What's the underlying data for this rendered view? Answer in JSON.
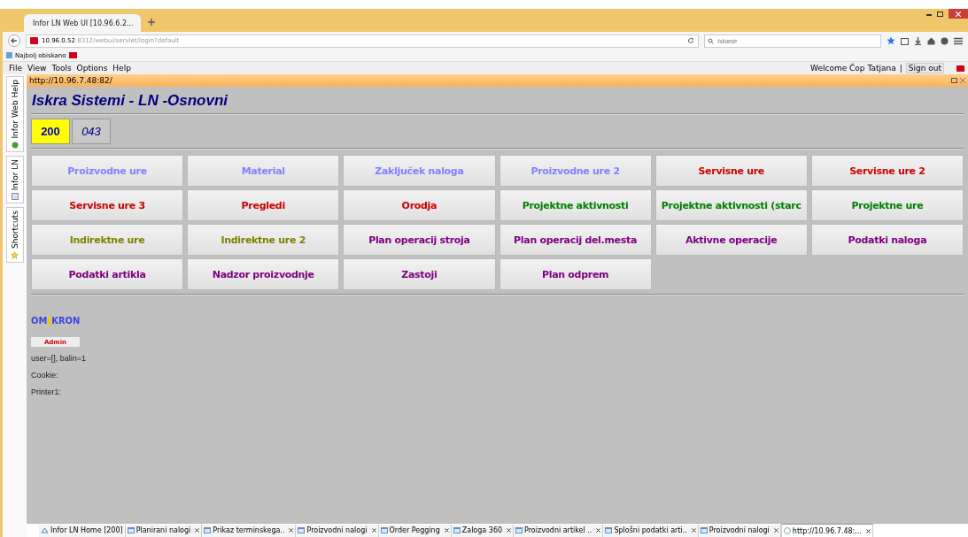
{
  "browser": {
    "tab_title": "Infor LN Web UI [10.96.6.2...",
    "url_host": "10.96.0.52",
    "url_rest": ":8312/webui/servlet/login?default",
    "search": {
      "placeholder": "Iskanje"
    },
    "bookmark": "Najbolj obiskano"
  },
  "menu": [
    "File",
    "View",
    "Tools",
    "Options",
    "Help"
  ],
  "user": {
    "welcome": "Welcome Čop Tatjana",
    "separator": "|",
    "sign_out": "Sign out"
  },
  "side_tabs": [
    {
      "label": "Infor Web Help",
      "kind": "help"
    },
    {
      "label": "Infor LN",
      "kind": "list"
    },
    {
      "label": "Shortcuts",
      "kind": "star"
    }
  ],
  "panel": {
    "url": "http://10.96.7.48:82/",
    "title": "Iskra Sistemi - LN -Osnovni",
    "companies": [
      {
        "label": "200",
        "selected": true
      },
      {
        "label": "043",
        "selected": false
      }
    ],
    "tiles": [
      {
        "label": "Proizvodne ure",
        "color": "#8080ff"
      },
      {
        "label": "Material",
        "color": "#8080ff"
      },
      {
        "label": "Zaključek naloga",
        "color": "#8080ff"
      },
      {
        "label": "Proizvodne ure 2",
        "color": "#8080ff"
      },
      {
        "label": "Servisne ure",
        "color": "#cc0000"
      },
      {
        "label": "Servisne ure 2",
        "color": "#cc0000"
      },
      {
        "label": "Servisne ure 3",
        "color": "#cc0000"
      },
      {
        "label": "Pregledi",
        "color": "#cc0000"
      },
      {
        "label": "Orodja",
        "color": "#cc0000"
      },
      {
        "label": "Projektne aktivnosti",
        "color": "#008000"
      },
      {
        "label": "Projektne aktivnosti (starc",
        "color": "#008000"
      },
      {
        "label": "Projektne ure",
        "color": "#008000"
      },
      {
        "label": "Indirektne ure",
        "color": "#808000"
      },
      {
        "label": "Indirektne ure 2",
        "color": "#808000"
      },
      {
        "label": "Plan operacij stroja",
        "color": "#800080"
      },
      {
        "label": "Plan operacij del.mesta",
        "color": "#800080"
      },
      {
        "label": "Aktivne operacije",
        "color": "#800080"
      },
      {
        "label": "Podatki naloga",
        "color": "#800080"
      },
      {
        "label": "Podatki artikla",
        "color": "#800080"
      },
      {
        "label": "Nadzor proizvodnje",
        "color": "#800080"
      },
      {
        "label": "Zastoji",
        "color": "#800080"
      },
      {
        "label": "Plan odprem",
        "color": "#800080"
      }
    ],
    "logo": [
      "OM",
      "KRON"
    ],
    "admin_button": "Admin",
    "info_lines": [
      "user=[], balin=1",
      "Cookie:",
      "Printer1:"
    ]
  },
  "bottom_tabs": [
    {
      "label": "Infor LN Home [200]",
      "kind": "home",
      "selected": false,
      "closable": false
    },
    {
      "label": "Planirani nalogi",
      "kind": "doc",
      "selected": false,
      "closable": true
    },
    {
      "label": "Prikaz terminskega..",
      "kind": "doc",
      "selected": false,
      "closable": true
    },
    {
      "label": "Proizvodni nalogi",
      "kind": "doc",
      "selected": false,
      "closable": true
    },
    {
      "label": "Order Pegging",
      "kind": "doc",
      "selected": false,
      "closable": true
    },
    {
      "label": "Zaloga 360",
      "kind": "doc",
      "selected": false,
      "closable": true
    },
    {
      "label": "Proizvodni artikel ..",
      "kind": "doc",
      "selected": false,
      "closable": true
    },
    {
      "label": "Splošni podatki arti..",
      "kind": "doc",
      "selected": false,
      "closable": true
    },
    {
      "label": "Proizvodni nalogi",
      "kind": "doc",
      "selected": false,
      "closable": true
    },
    {
      "label": "http://10.96.7.48:...",
      "kind": "web",
      "selected": true,
      "closable": true
    }
  ]
}
